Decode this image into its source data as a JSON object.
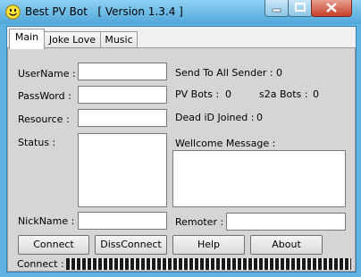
{
  "window": {
    "title": "Best PV Bot   [ Version 1.3.4 ]",
    "icon": "smiley-icon",
    "controls": [
      "minimize-icon",
      "maximize-icon",
      "close-icon"
    ]
  },
  "tabs": [
    {
      "label": "Main",
      "active": true
    },
    {
      "label": "Joke Love",
      "active": false
    },
    {
      "label": "Music",
      "active": false
    }
  ],
  "form": {
    "username_label": "UserName :",
    "password_label": "PassWord :",
    "resource_label": "Resource :",
    "status_label": "Status :",
    "nickname_label": "NickName :",
    "username_value": "",
    "password_value": "",
    "resource_value": "",
    "status_value": "",
    "nickname_value": ""
  },
  "stats": {
    "send_to_all_label": "Send To All Sender :",
    "send_to_all_value": "0",
    "pv_bots_label": "PV Bots :",
    "pv_bots_value": "0",
    "s2a_bots_label": "s2a Bots :",
    "s2a_bots_value": "0",
    "dead_id_label": "Dead iD Joined :",
    "dead_id_value": "0",
    "welcome_label": "Wellcome Message :",
    "welcome_value": "",
    "remoter_label": "Remoter :",
    "remoter_value": ""
  },
  "buttons": {
    "connect": "Connect",
    "disconnect": "DissConnect",
    "help": "Help",
    "about": "About"
  },
  "status_bar": {
    "connect_label": "Connect :"
  },
  "colors": {
    "titlebar": "#5fb3e2",
    "panel": "#d5d5d5",
    "close_button": "#c7402b"
  }
}
